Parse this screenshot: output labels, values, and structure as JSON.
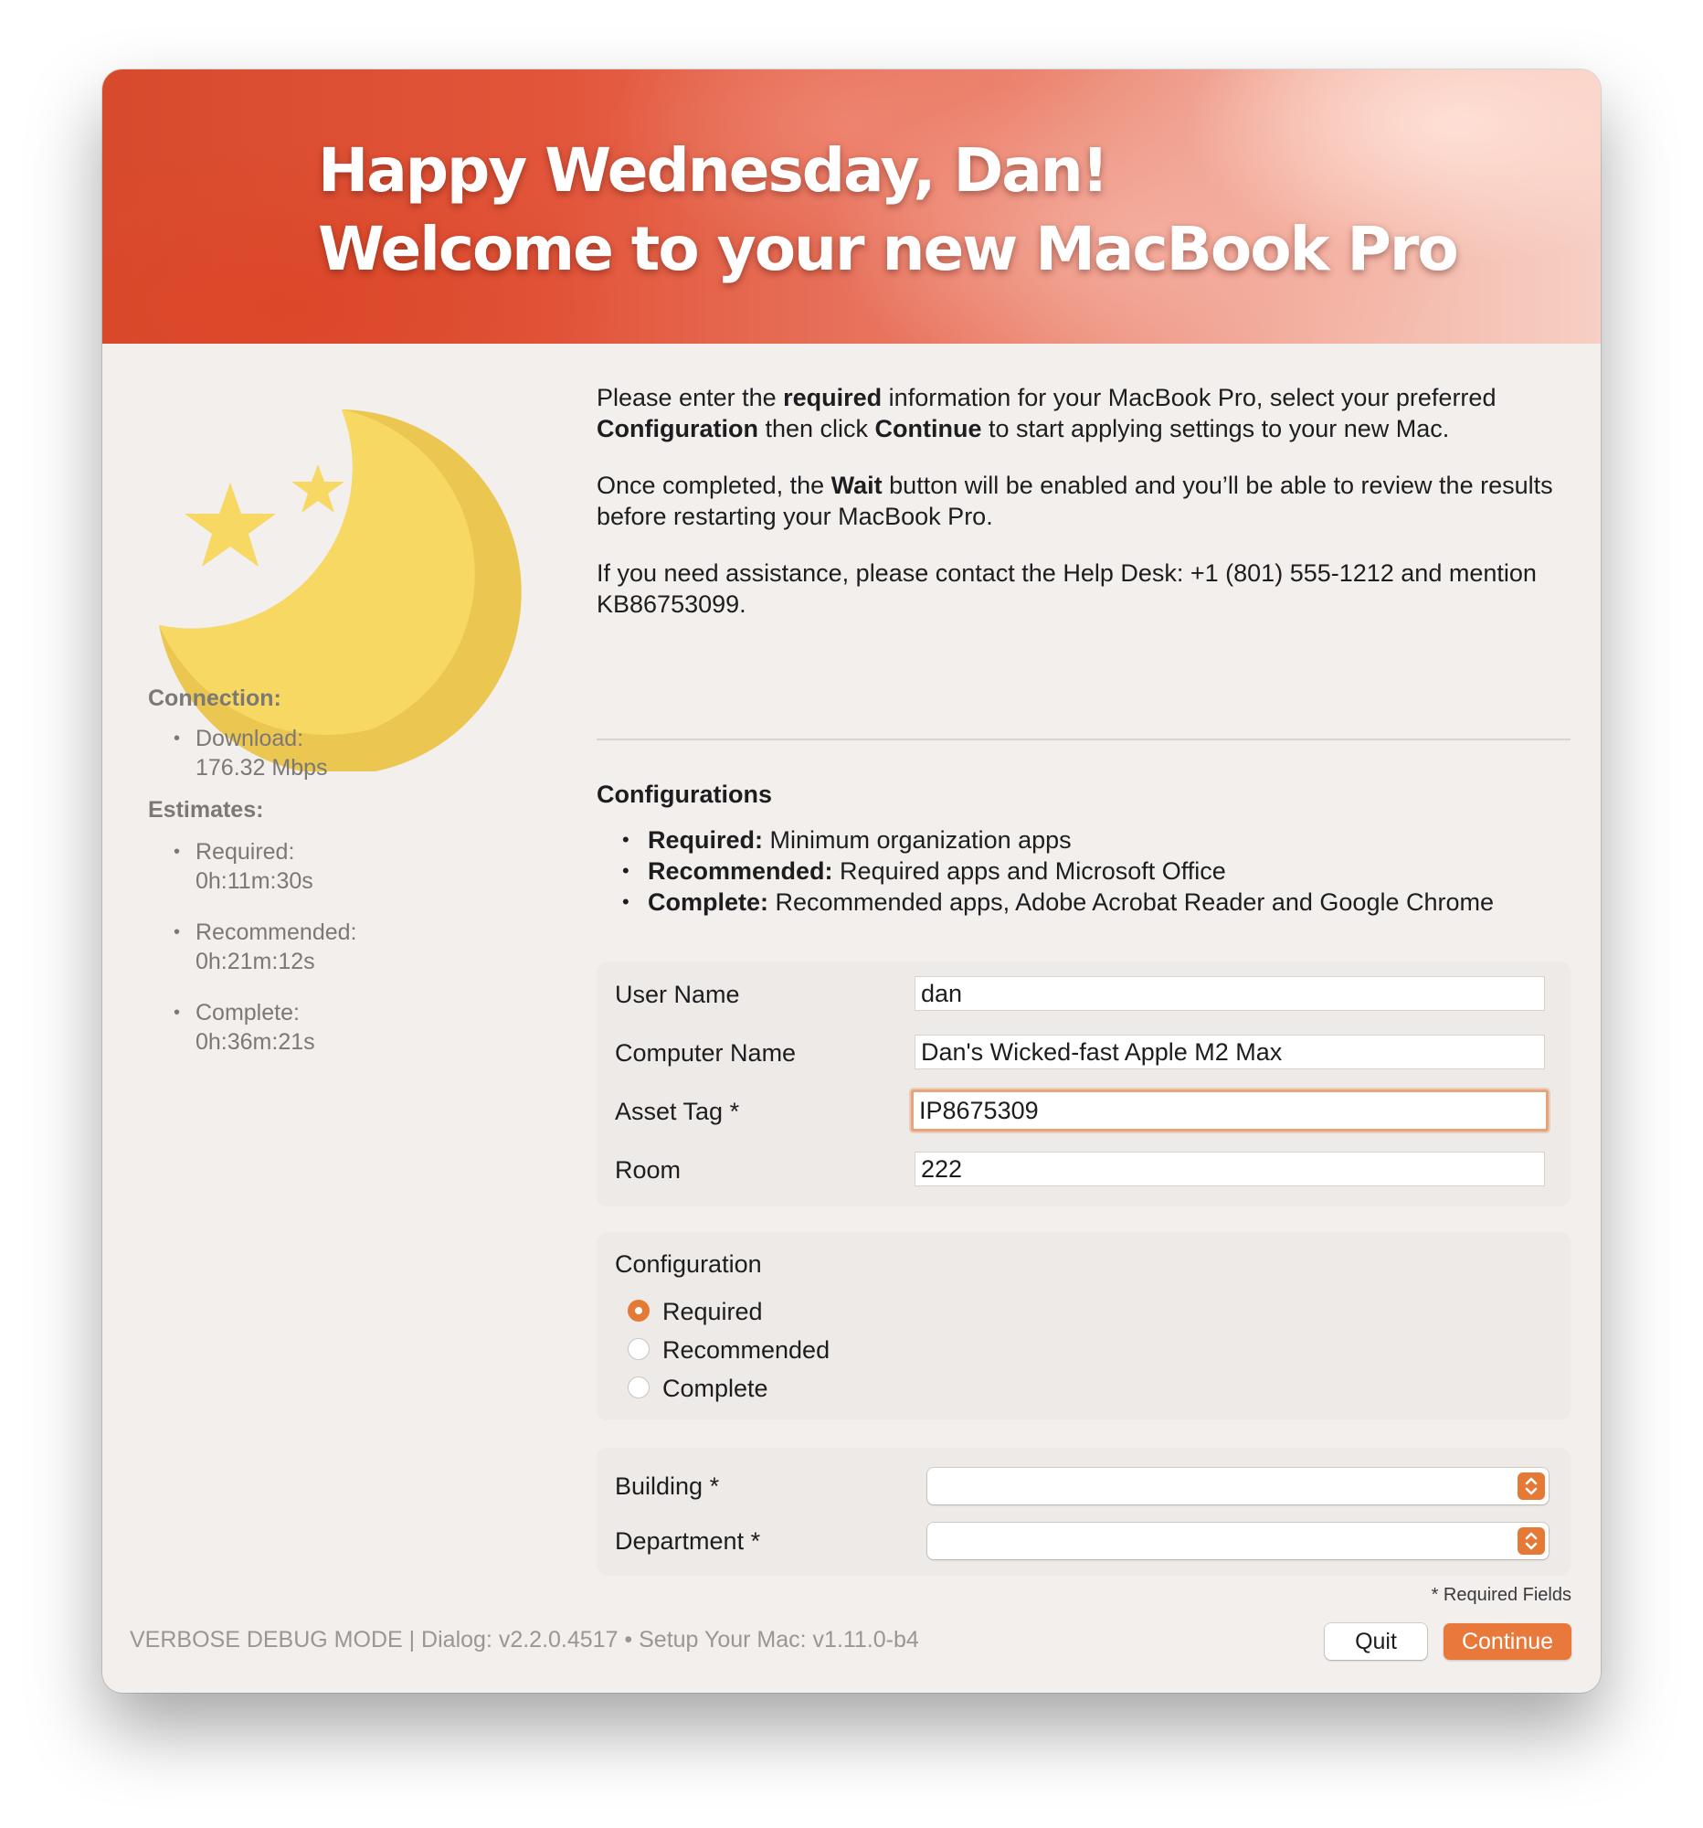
{
  "banner": {
    "line1": "Happy Wednesday, Dan!",
    "line2": "Welcome to your new MacBook Pro"
  },
  "sidebar": {
    "icon": "moon-and-stars-icon",
    "connection_heading": "Connection:",
    "download_label": "Download:",
    "download_value": "176.32 Mbps",
    "estimates_heading": "Estimates:",
    "estimates": [
      {
        "label": "Required:",
        "value": "0h:11m:30s"
      },
      {
        "label": "Recommended:",
        "value": "0h:21m:12s"
      },
      {
        "label": "Complete:",
        "value": "0h:36m:21s"
      }
    ]
  },
  "intro": {
    "p1": {
      "t1": "Please enter the ",
      "b1": "required",
      "t2": " information for your MacBook Pro, select your preferred ",
      "b2": "Configuration",
      "t3": " then click ",
      "b3": "Continue",
      "t4": " to start applying settings to your new Mac."
    },
    "p2": {
      "t1": "Once completed, the ",
      "b1": "Wait",
      "t2": " button will be enabled and you’ll be able to review the results before restarting your MacBook Pro."
    },
    "p3": "If you need assistance, please contact the Help Desk: +1 (801) 555-1212 and mention KB86753099."
  },
  "configurations": {
    "title": "Configurations",
    "items": [
      {
        "name": "Required:",
        "desc": " Minimum organization apps"
      },
      {
        "name": "Recommended:",
        "desc": " Required apps and Microsoft Office"
      },
      {
        "name": "Complete:",
        "desc": " Recommended apps, Adobe Acrobat Reader and Google Chrome"
      }
    ]
  },
  "form": {
    "user_name": {
      "label": "User Name",
      "value": "dan"
    },
    "computer_name": {
      "label": "Computer Name",
      "value": "Dan's Wicked-fast Apple M2 Max"
    },
    "asset_tag": {
      "label": "Asset Tag *",
      "value": "IP8675309"
    },
    "room": {
      "label": "Room",
      "value": "222"
    }
  },
  "configuration_choice": {
    "heading": "Configuration",
    "options": [
      "Required",
      "Recommended",
      "Complete"
    ],
    "selected": "Required"
  },
  "selects": {
    "building": {
      "label": "Building *",
      "value": ""
    },
    "department": {
      "label": "Department *",
      "value": ""
    }
  },
  "colors": {
    "accent": "#e8793a",
    "moon": "#f7d862"
  },
  "footer": {
    "required_note": "* Required Fields",
    "info": "VERBOSE DEBUG MODE | Dialog: v2.2.0.4517 • Setup Your Mac: v1.11.0-b4",
    "quit_label": "Quit",
    "continue_label": "Continue"
  }
}
